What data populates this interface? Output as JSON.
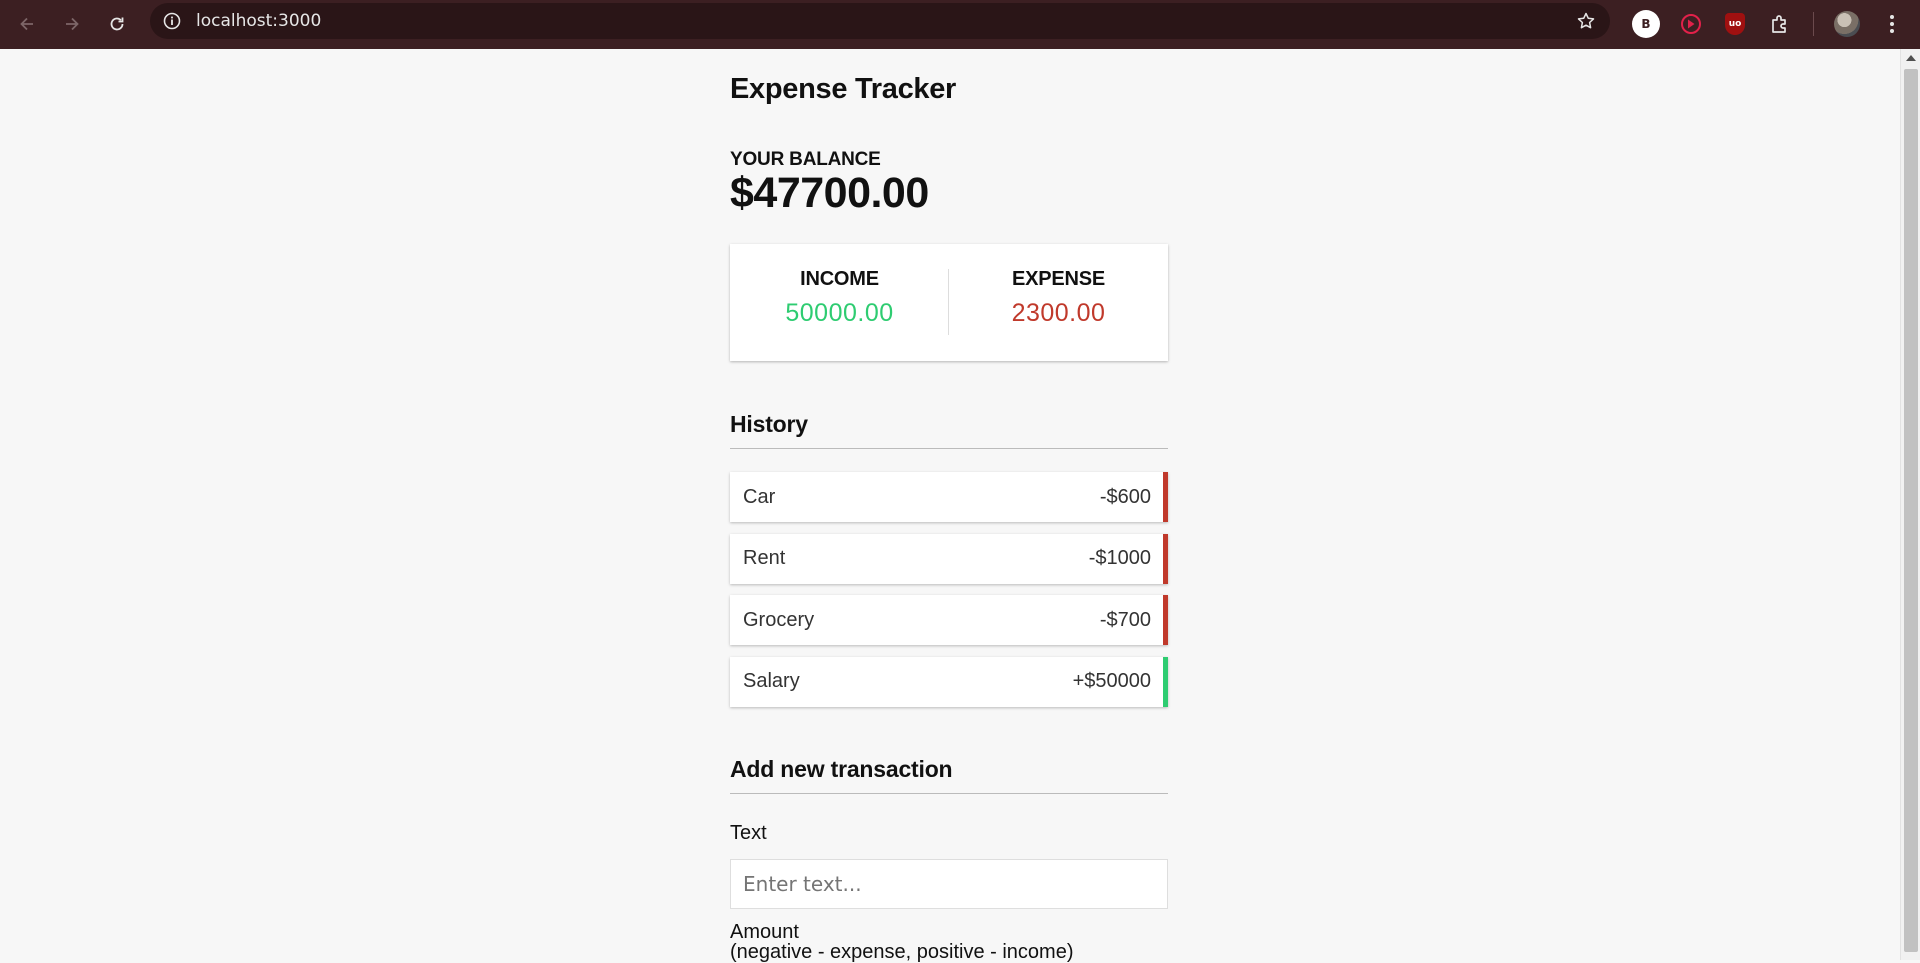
{
  "browser": {
    "url": "localhost:3000",
    "extensions": [
      {
        "name": "b-extension",
        "label": "B"
      },
      {
        "name": "play-extension"
      },
      {
        "name": "ublock-extension",
        "label": "uo"
      },
      {
        "name": "puzzle-extension"
      }
    ]
  },
  "app": {
    "title": "Expense Tracker",
    "balance_label": "YOUR BALANCE",
    "balance_value": "$47700.00"
  },
  "summary": {
    "income_label": "INCOME",
    "income_value": "50000.00",
    "expense_label": "EXPENSE",
    "expense_value": "2300.00",
    "income_color": "#2ecc71",
    "expense_color": "#c0392b"
  },
  "history": {
    "title": "History",
    "items": [
      {
        "text": "Car",
        "amount": "-$600",
        "type": "minus"
      },
      {
        "text": "Rent",
        "amount": "-$1000",
        "type": "minus"
      },
      {
        "text": "Grocery",
        "amount": "-$700",
        "type": "minus"
      },
      {
        "text": "Salary",
        "amount": "+$50000",
        "type": "plus"
      }
    ]
  },
  "add_transaction": {
    "title": "Add new transaction",
    "text_label": "Text",
    "text_placeholder": "Enter text...",
    "amount_label": "Amount",
    "amount_hint": "(negative - expense, positive - income)"
  }
}
